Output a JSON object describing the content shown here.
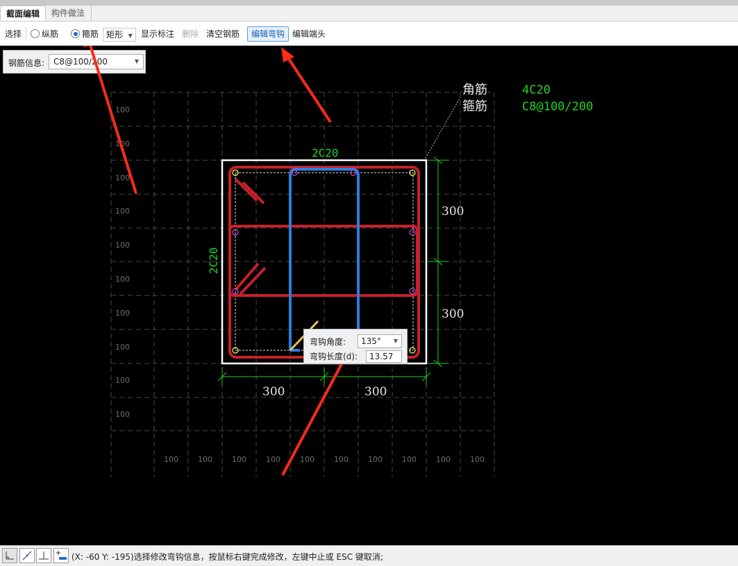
{
  "tabs": [
    "截面编辑",
    "构件做法"
  ],
  "toolbar": {
    "select": "选择",
    "longitudinal": "纵筋",
    "stirrup": "箍筋",
    "shape": "矩形",
    "show_annot": "显示标注",
    "delete": "删除",
    "clear": "清空钢筋",
    "edit_hook": "编辑弯钩",
    "edit_end": "编辑端头"
  },
  "rebar_info": {
    "label": "钢筋信息:",
    "value": "C8@100/200"
  },
  "drawing": {
    "grid_label": "100",
    "callout": {
      "corner_label": "角筋",
      "corner_value": "4C20",
      "stirrup_label": "箍筋",
      "stirrup_value": "C8@100/200"
    },
    "top_rebar": "2C20",
    "side_rebar": "2C20",
    "dim_right_top": "300",
    "dim_right_bottom": "300",
    "dim_bottom_left": "300",
    "dim_bottom_right": "300"
  },
  "hook_dialog": {
    "angle_label": "弯钩角度:",
    "angle_value": "135°",
    "length_label": "弯钩长度(d):",
    "length_value": "13.57"
  },
  "status": {
    "text": "(X: -60 Y: -195)选择修改弯钩信息，按鼠标右键完成修改，左键中止或 ESC 键取消;"
  },
  "colors": {
    "rebar_red": "#c8202a",
    "rebar_blue": "#2a7fe0",
    "dim_green": "#22d022",
    "annotation_red": "#ff2a1a"
  }
}
